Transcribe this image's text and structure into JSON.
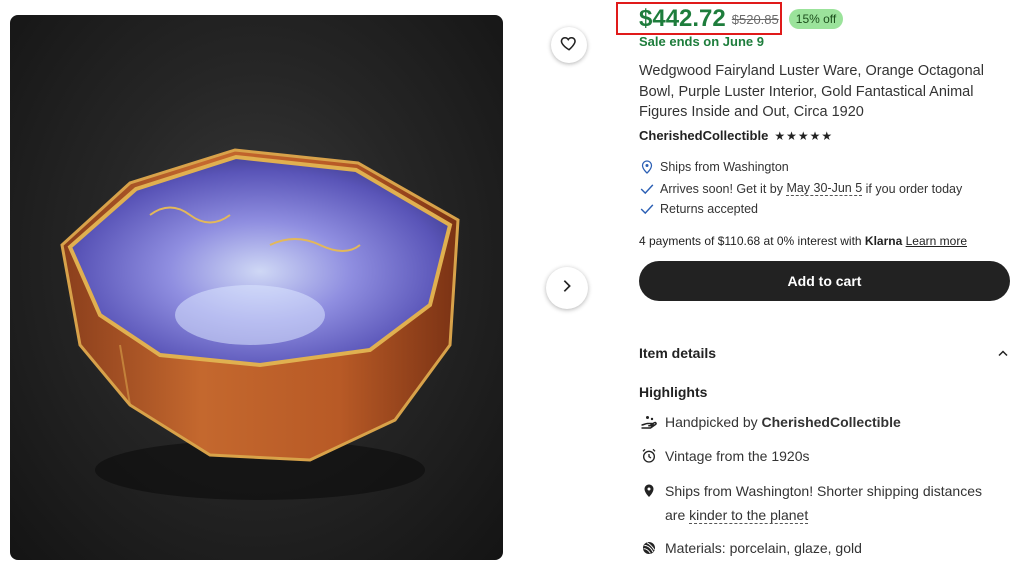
{
  "listing": {
    "price": "$442.72",
    "original_price": "$520.85",
    "discount": "15% off",
    "sale_text": "Sale ends on June 9",
    "title": "Wedgwood Fairyland Luster Ware, Orange Octagonal Bowl, Purple Luster Interior, Gold Fantastical Animal Figures Inside and Out, Circa 1920",
    "shop_name": "CherishedCollectible",
    "rating_stars": "★★★★★",
    "ships_from": "Ships from Washington",
    "arrives_prefix": "Arrives soon! Get it by ",
    "arrives_dates": "May 30-Jun 5",
    "arrives_suffix": " if you order today",
    "returns": "Returns accepted",
    "klarna_text": "4 payments of $110.68 at 0% interest with ",
    "klarna_brand": "Klarna",
    "klarna_link": "Learn more",
    "add_to_cart": "Add to cart"
  },
  "details": {
    "header": "Item details",
    "highlights_title": "Highlights",
    "handpicked_prefix": "Handpicked by ",
    "handpicked_shop": "CherishedCollectible",
    "vintage": "Vintage from the 1920s",
    "ships_line1": "Ships from Washington! Shorter shipping distances",
    "ships_line2_prefix": "are ",
    "ships_line2_link": "kinder to the planet",
    "materials": "Materials: porcelain, glaze, gold"
  },
  "icons": {
    "favorite": "heart-icon",
    "next_image": "chevron-right-icon",
    "location": "map-pin-icon",
    "check": "check-icon",
    "collapse": "chevron-up-icon",
    "handpicked": "hand-icon",
    "vintage": "alarm-clock-icon",
    "materials": "yarn-ball-icon"
  },
  "colors": {
    "price_green": "#1e7d3c",
    "badge_green": "#9be39b",
    "cart_button": "#222222",
    "highlight_border": "#e01a1a"
  }
}
